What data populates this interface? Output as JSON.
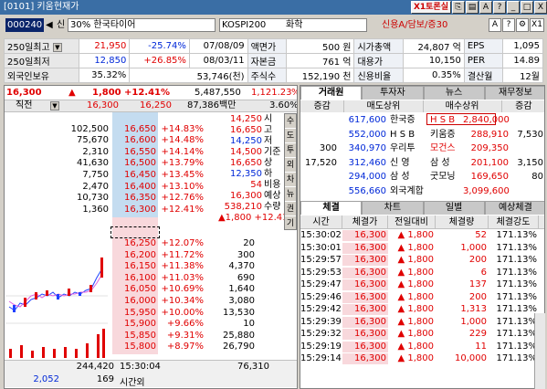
{
  "window": {
    "title": "[0101] 키움현재가",
    "toron_label": "X1토론실",
    "buttons": [
      "icon-1",
      "icon-2",
      "A",
      "?",
      "_",
      "□",
      "X"
    ]
  },
  "toolbar": {
    "code": "000240",
    "icons": [
      "◀",
      "신",
      "30%"
    ],
    "name": "한국타이어",
    "market": "KOSPI200",
    "industry": "화학",
    "credit": "신용A/담보/증30",
    "right_buttons": [
      "A",
      "?",
      "",
      "X1"
    ]
  },
  "info": [
    [
      "250일최고",
      "21,950",
      "-25.74%",
      "07/08/09",
      "액면가",
      "500 원",
      "시가총액",
      "24,807 억",
      "EPS",
      "1,095"
    ],
    [
      "250일최저",
      "12,850",
      "+26.85%",
      "08/03/11",
      "자본금",
      "761 억",
      "대용가",
      "10,150",
      "PER",
      "14.89"
    ],
    [
      "외국인보유",
      "35.32%",
      "",
      "53,746(천)",
      "주식수",
      "152,190 천",
      "신용비율",
      "0.35%",
      "결산월",
      "12월"
    ]
  ],
  "current": {
    "price": "16,300",
    "arrow": "▲",
    "change": "1,800",
    "rate": "+12.41%",
    "volume": "5,487,550",
    "amount": "1,121.23",
    "unit": "%"
  },
  "header": {
    "label": "직전",
    "c1": "16,300",
    "c2": "16,250",
    "c3": "87,386백만",
    "c4": "3.60%"
  },
  "asks": [
    {
      "qty": "",
      "price": "",
      "rate": ""
    },
    {
      "qty": "102,500",
      "price": "16,650",
      "rate": "+14.83%"
    },
    {
      "qty": "75,670",
      "price": "16,600",
      "rate": "+14.48%"
    },
    {
      "qty": "2,310",
      "price": "16,550",
      "rate": "+14.14%"
    },
    {
      "qty": "41,630",
      "price": "16,500",
      "rate": "+13.79%"
    },
    {
      "qty": "7,750",
      "price": "16,450",
      "rate": "+13.45%"
    },
    {
      "qty": "2,470",
      "price": "16,400",
      "rate": "+13.10%"
    },
    {
      "qty": "10,730",
      "price": "16,350",
      "rate": "+12.76%"
    },
    {
      "qty": "1,360",
      "price": "16,300",
      "rate": "+12.41%"
    }
  ],
  "bids": [
    {
      "price": "16,250",
      "rate": "+12.07%",
      "qty": "20"
    },
    {
      "price": "16,200",
      "rate": "+11.72%",
      "qty": "300"
    },
    {
      "price": "16,150",
      "rate": "+11.38%",
      "qty": "4,370"
    },
    {
      "price": "16,100",
      "rate": "+11.03%",
      "qty": "690"
    },
    {
      "price": "16,050",
      "rate": "+10.69%",
      "qty": "1,640"
    },
    {
      "price": "16,000",
      "rate": "+10.34%",
      "qty": "3,080"
    },
    {
      "price": "15,950",
      "rate": "+10.00%",
      "qty": "13,530"
    },
    {
      "price": "15,900",
      "rate": "+9.66%",
      "qty": "10"
    },
    {
      "price": "15,850",
      "rate": "+9.31%",
      "qty": "25,880"
    },
    {
      "price": "15,800",
      "rate": "+8.97%",
      "qty": "26,790"
    }
  ],
  "daily": [
    {
      "v": "14,250",
      "l": "시"
    },
    {
      "v": "16,650",
      "l": "고"
    },
    {
      "v": "14,250",
      "l": "저"
    },
    {
      "v": "14,500",
      "l": "기준"
    },
    {
      "v": "16,650",
      "l": "상"
    },
    {
      "v": "12,350",
      "l": "하"
    },
    {
      "v": "54",
      "l": "비용"
    },
    {
      "v": "16,300",
      "l": "예상"
    },
    {
      "v": "538,210",
      "l": "수량"
    },
    {
      "v": "▲1,800 +12.41%",
      "l": ""
    }
  ],
  "side_tabs": [
    "수",
    "도",
    "투",
    "외",
    "차",
    "뉴",
    "권",
    "기"
  ],
  "footer": {
    "ask_total": "244,420",
    "time": "15:30:04",
    "bid_total": "76,310",
    "left_a": "2,052",
    "left_b": "169",
    "time_label": "시간외"
  },
  "broker": {
    "tabs": [
      "거래원",
      "투자자",
      "뉴스",
      "재무정보"
    ],
    "cols": [
      "증감",
      "매도상위",
      "매수상위",
      "증감"
    ],
    "rows": [
      [
        "",
        "617,600",
        "한국증",
        "H S B",
        "2,840,000",
        ""
      ],
      [
        "",
        "552,000",
        "H S B",
        "키움증",
        "288,910",
        "7,530"
      ],
      [
        "300",
        "340,970",
        "우리투",
        "모건스",
        "209,350",
        ""
      ],
      [
        "17,520",
        "312,460",
        "신 영",
        "삼 성",
        "201,100",
        "3,150"
      ],
      [
        "",
        "294,000",
        "삼 성",
        "굿모닝",
        "169,650",
        "80"
      ],
      [
        "",
        "556,660",
        "외국계합",
        "",
        "3,099,600",
        ""
      ]
    ]
  },
  "ticks": {
    "tabs": [
      "체결",
      "차트",
      "일별",
      "예상체결"
    ],
    "cols": [
      "시간",
      "체결가",
      "전일대비",
      "체결량",
      "체결강도"
    ],
    "rows": [
      [
        "15:30:02",
        "16,300",
        "▲",
        "1,800",
        "52",
        "171.13%"
      ],
      [
        "15:30:01",
        "16,300",
        "▲",
        "1,800",
        "1,000",
        "171.13%"
      ],
      [
        "15:29:57",
        "16,300",
        "▲",
        "1,800",
        "200",
        "171.13%"
      ],
      [
        "15:29:53",
        "16,300",
        "▲",
        "1,800",
        "6",
        "171.13%"
      ],
      [
        "15:29:47",
        "16,300",
        "▲",
        "1,800",
        "137",
        "171.13%"
      ],
      [
        "15:29:46",
        "16,300",
        "▲",
        "1,800",
        "200",
        "171.13%"
      ],
      [
        "15:29:42",
        "16,300",
        "▲",
        "1,800",
        "1,313",
        "171.13%"
      ],
      [
        "15:29:39",
        "16,300",
        "▲",
        "1,800",
        "1,000",
        "171.13%"
      ],
      [
        "15:29:32",
        "16,300",
        "▲",
        "1,800",
        "229",
        "171.13%"
      ],
      [
        "15:29:19",
        "16,300",
        "▲",
        "1,800",
        "11",
        "171.13%"
      ],
      [
        "15:29:14",
        "16,300",
        "▲",
        "1,800",
        "10,000",
        "171.13%"
      ]
    ]
  },
  "colors": {
    "up": "#e00000",
    "down": "#0028d8",
    "ask_bg": "#c4dcf0",
    "bid_bg": "#f8d8dc"
  }
}
